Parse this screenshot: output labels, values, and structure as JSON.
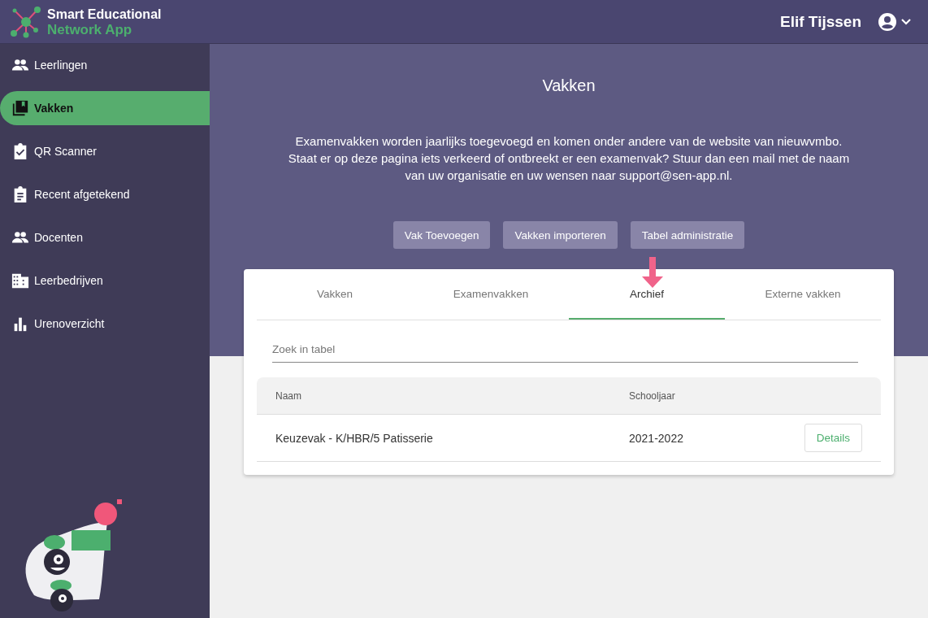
{
  "app": {
    "logo_line_1": "Smart Educational",
    "logo_line_2": "Network App"
  },
  "user": {
    "name": "Elif Tijssen"
  },
  "sidebar": {
    "items": [
      {
        "label": "Leerlingen",
        "kind": "people",
        "selected": false
      },
      {
        "label": "Vakken",
        "kind": "books",
        "selected": true
      },
      {
        "label": "QR Scanner",
        "kind": "check",
        "selected": false
      },
      {
        "label": "Recent afgetekend",
        "kind": "list",
        "selected": false
      },
      {
        "label": "Docenten",
        "kind": "people",
        "selected": false
      },
      {
        "label": "Leerbedrijven",
        "kind": "building",
        "selected": false
      },
      {
        "label": "Urenoverzicht",
        "kind": "bars",
        "selected": false
      }
    ]
  },
  "page": {
    "title": "Vakken",
    "intro": "Examenvakken worden jaarlijks toegevoegd en komen onder andere van de website van nieuwvmbo. Staat er op deze pagina iets verkeerd of ontbreekt er een examenvak? Stuur dan een mail met de naam van uw organisatie en uw wensen naar support@sen-app.nl.",
    "buttons": [
      "Vak Toevoegen",
      "Vakken importeren",
      "Tabel administratie"
    ]
  },
  "tabs": [
    {
      "label": "Vakken",
      "selected": false
    },
    {
      "label": "Examenvakken",
      "selected": false
    },
    {
      "label": "Archief",
      "selected": true
    },
    {
      "label": "Externe vakken",
      "selected": false
    }
  ],
  "search": {
    "placeholder": "Zoek in tabel"
  },
  "table": {
    "columns": [
      "Naam",
      "Schooljaar"
    ],
    "rows": [
      {
        "naam": "Keuzevak - K/HBR/5 Patisserie",
        "schooljaar": "2021-2022",
        "action": "Details"
      }
    ]
  }
}
